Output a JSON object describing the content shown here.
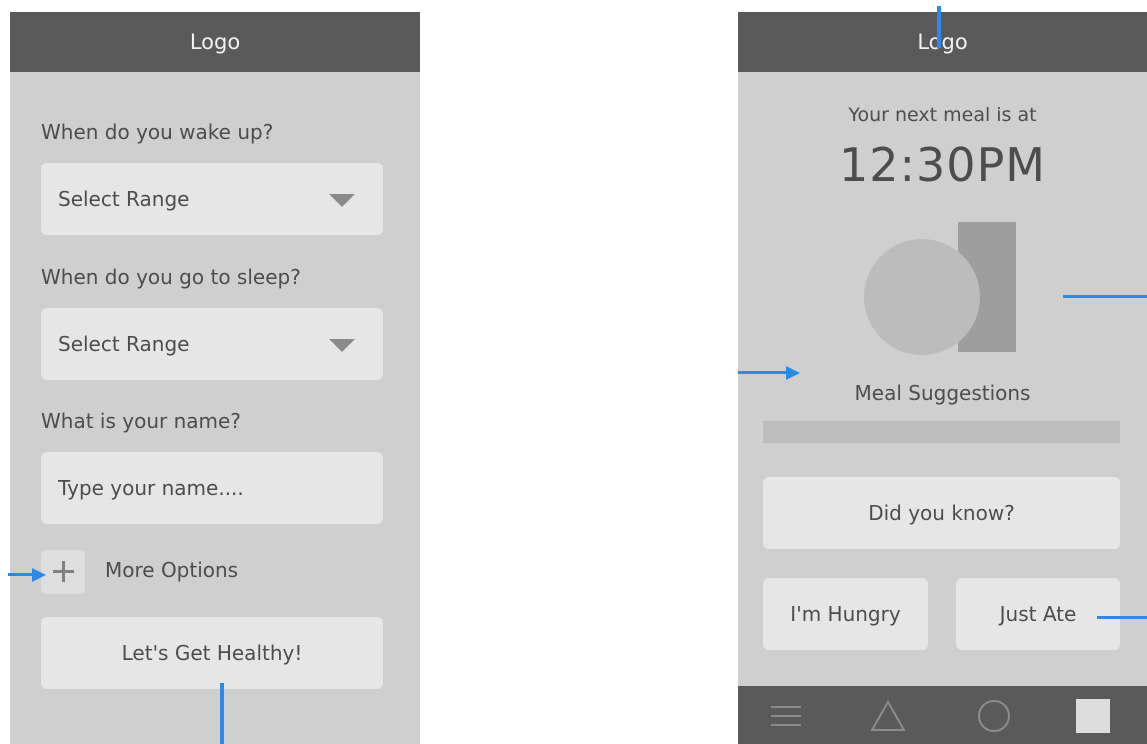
{
  "left_screen": {
    "header": {
      "logo": "Logo"
    },
    "questions": [
      {
        "label": "When do you wake up?",
        "control": "select",
        "value": "Select Range"
      },
      {
        "label": "When do you go to sleep?",
        "control": "select",
        "value": "Select Range"
      },
      {
        "label": "What is your name?",
        "control": "input",
        "placeholder": "Type your name...."
      }
    ],
    "more_options": {
      "label": "More Options",
      "icon": "plus-icon"
    },
    "cta": {
      "label": "Let's Get Healthy!"
    }
  },
  "right_screen": {
    "header": {
      "logo": "Logo"
    },
    "meal": {
      "intro": "Your next meal is at",
      "time": "12:30PM"
    },
    "suggestions": {
      "label": "Meal Suggestions"
    },
    "did_you_know": {
      "label": "Did you know?"
    },
    "actions": {
      "hungry": "I'm Hungry",
      "just_ate": "Just Ate"
    },
    "bottom_nav": {
      "items": [
        {
          "icon": "menu-icon"
        },
        {
          "icon": "triangle-icon"
        },
        {
          "icon": "circle-icon"
        },
        {
          "icon": "square-icon"
        }
      ]
    }
  },
  "colors": {
    "screen_bg": "#cfcfcf",
    "header_bg": "#5a5a5a",
    "control_bg": "#e6e6e6",
    "annotation": "#2a8ae6"
  }
}
